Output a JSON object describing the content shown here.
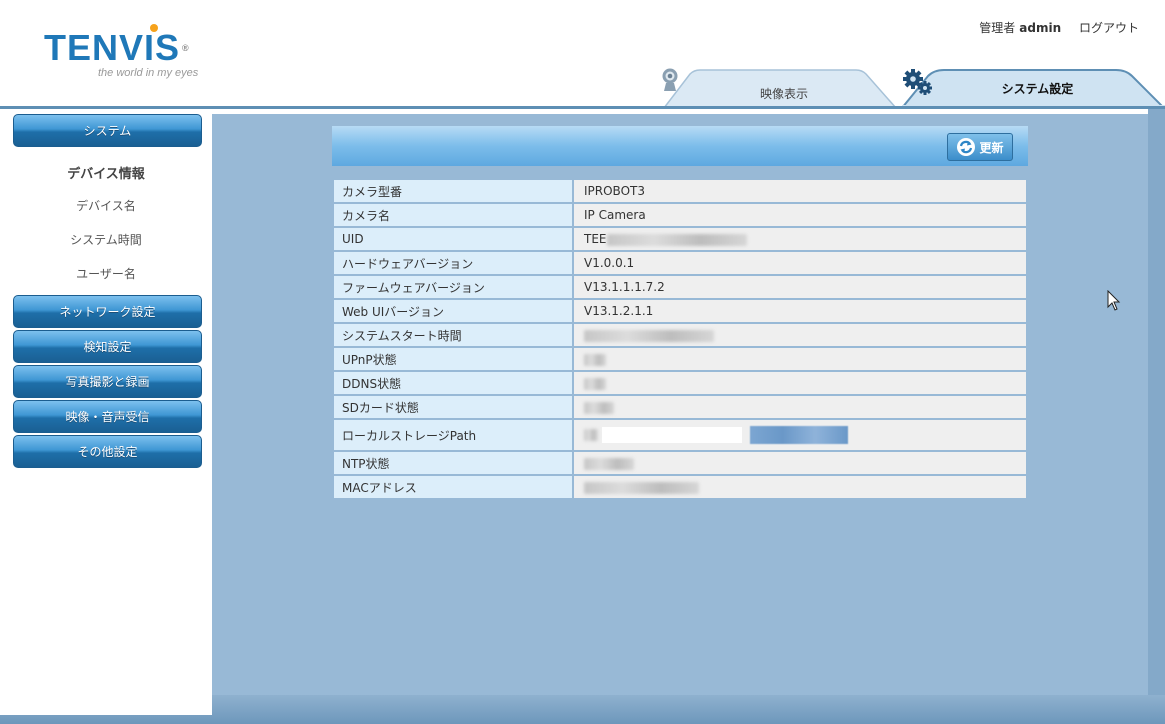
{
  "brand": {
    "logo": "TENVIS",
    "tagline": "the world in my eyes"
  },
  "user": {
    "role_label": "管理者",
    "name": "admin",
    "logout": "ログアウト"
  },
  "tabs": [
    {
      "label": "映像表示",
      "icon": "webcam-icon",
      "active": false
    },
    {
      "label": "システム設定",
      "icon": "gears-icon",
      "active": true
    }
  ],
  "sidebar": {
    "system": "システム",
    "submenu": {
      "title": "デバイス情報",
      "items": [
        "デバイス名",
        "システム時間",
        "ユーザー名"
      ]
    },
    "sections": [
      "ネットワーク設定",
      "検知設定",
      "写真撮影と録画",
      "映像・音声受信",
      "その他設定"
    ]
  },
  "panel": {
    "refresh_label": "更新"
  },
  "info_rows": [
    {
      "key": "カメラ型番",
      "value": "IPROBOT3"
    },
    {
      "key": "カメラ名",
      "value": "IP Camera"
    },
    {
      "key": "UID",
      "value": "TEE"
    },
    {
      "key": "ハードウェアバージョン",
      "value": "V1.0.0.1"
    },
    {
      "key": "ファームウェアバージョン",
      "value": "V13.1.1.1.7.2"
    },
    {
      "key": "Web UIバージョン",
      "value": "V13.1.2.1.1"
    },
    {
      "key": "システムスタート時間",
      "value": ""
    },
    {
      "key": "UPnP状態",
      "value": ""
    },
    {
      "key": "DDNS状態",
      "value": ""
    },
    {
      "key": "SDカード状態",
      "value": ""
    },
    {
      "key": "ローカルストレージPath",
      "value": ""
    },
    {
      "key": "NTP状態",
      "value": ""
    },
    {
      "key": "MACアドレス",
      "value": ""
    }
  ],
  "colors": {
    "brand_blue": "#1f78b8",
    "button_blue": "#3f97d4",
    "content_bg": "#98b9d6",
    "key_cell": "#dceefa",
    "value_cell": "#efefef"
  }
}
